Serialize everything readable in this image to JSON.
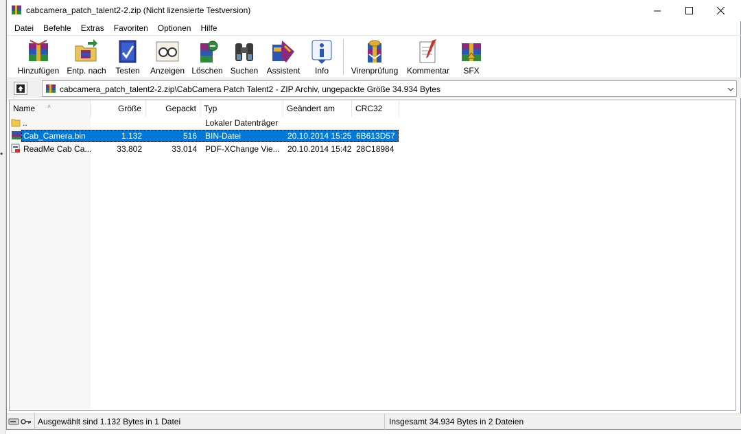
{
  "window": {
    "title": "cabcamera_patch_talent2-2.zip (Nicht lizensierte Testversion)"
  },
  "menu": [
    "Datei",
    "Befehle",
    "Extras",
    "Favoriten",
    "Optionen",
    "Hilfe"
  ],
  "toolbar": {
    "add": "Hinzufügen",
    "extract": "Entp. nach",
    "test": "Testen",
    "view": "Anzeigen",
    "delete": "Löschen",
    "find": "Suchen",
    "wizard": "Assistent",
    "info": "Info",
    "virus": "Virenprüfung",
    "comment": "Kommentar",
    "sfx": "SFX"
  },
  "address": {
    "path": "cabcamera_patch_talent2-2.zip\\CabCamera Patch Talent2 - ZIP Archiv, ungepackte Größe 34.934 Bytes"
  },
  "columns": {
    "name": "Name",
    "size": "Größe",
    "packed": "Gepackt",
    "type": "Typ",
    "modified": "Geändert am",
    "crc": "CRC32"
  },
  "rows": [
    {
      "name": "..",
      "size": "",
      "packed": "",
      "type": "Lokaler Datenträger",
      "modified": "",
      "crc": "",
      "icon": "folder-up-icon"
    },
    {
      "name": "Cab_Camera.bin",
      "size": "1.132",
      "packed": "516",
      "type": "BIN-Datei",
      "modified": "20.10.2014 15:25",
      "crc": "6B613D57",
      "icon": "archive-file-icon",
      "selected": true
    },
    {
      "name": "ReadMe Cab Ca...",
      "size": "33.802",
      "packed": "33.014",
      "type": "PDF-XChange Vie...",
      "modified": "20.10.2014 15:42",
      "crc": "28C18984",
      "icon": "pdf-file-icon"
    }
  ],
  "status": {
    "left": "Ausgewählt sind 1.132 Bytes in 1 Datei",
    "right": "Insgesamt 34.934 Bytes in 2 Dateien"
  },
  "colors": {
    "selection": "#0078d7",
    "border": "#6a8fc9"
  }
}
